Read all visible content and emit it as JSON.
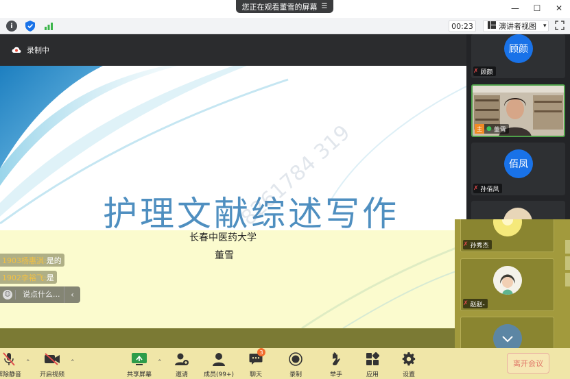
{
  "titlebar": {
    "share_notice": "您正在观看董雪的屏幕",
    "menu_icon": "menu-icon",
    "minimize": "—",
    "maximize": "☐",
    "close": "✕"
  },
  "infobar": {
    "info_icon": "i",
    "timer": "00:23",
    "view_mode": "演讲者视图",
    "view_caret": "▾"
  },
  "recording": {
    "label": "录制中"
  },
  "slide": {
    "title": "护理文献综述写作",
    "university": "长春中医药大学",
    "author": "董雪",
    "watermark": "8261784 319"
  },
  "chat": {
    "messages": [
      {
        "name": "1903杨惠淇:",
        "text": "是的"
      },
      {
        "name": "1902李裕飞:",
        "text": "是"
      }
    ],
    "input_placeholder": "说点什么..."
  },
  "participants": [
    {
      "name": "顾颜",
      "avatar_text": "顾颜",
      "muted": true
    },
    {
      "name": "董雪",
      "muted": false,
      "host": true,
      "active": true
    },
    {
      "name": "孙佰凤",
      "avatar_text": "佰凤",
      "muted": true
    },
    {
      "name": "孙秀杰",
      "muted": true
    },
    {
      "name": "赵赵-",
      "muted": true
    },
    {
      "name": "",
      "muted": true
    }
  ],
  "toolbar": {
    "unmute": "解除静音",
    "video": "开启视频",
    "share": "共享屏幕",
    "invite": "邀请",
    "members": "成员(99+)",
    "chat": "聊天",
    "chat_badge": "3",
    "record": "录制",
    "raise_hand": "举手",
    "apps": "应用",
    "settings": "设置",
    "leave": "离开会议"
  },
  "colors": {
    "accent_blue": "#1972e8",
    "active_green": "#4fa14a",
    "toolbar_bg": "#f0e6a8",
    "leave_red": "#e17a6a",
    "slide_title": "#4f8fc0"
  }
}
